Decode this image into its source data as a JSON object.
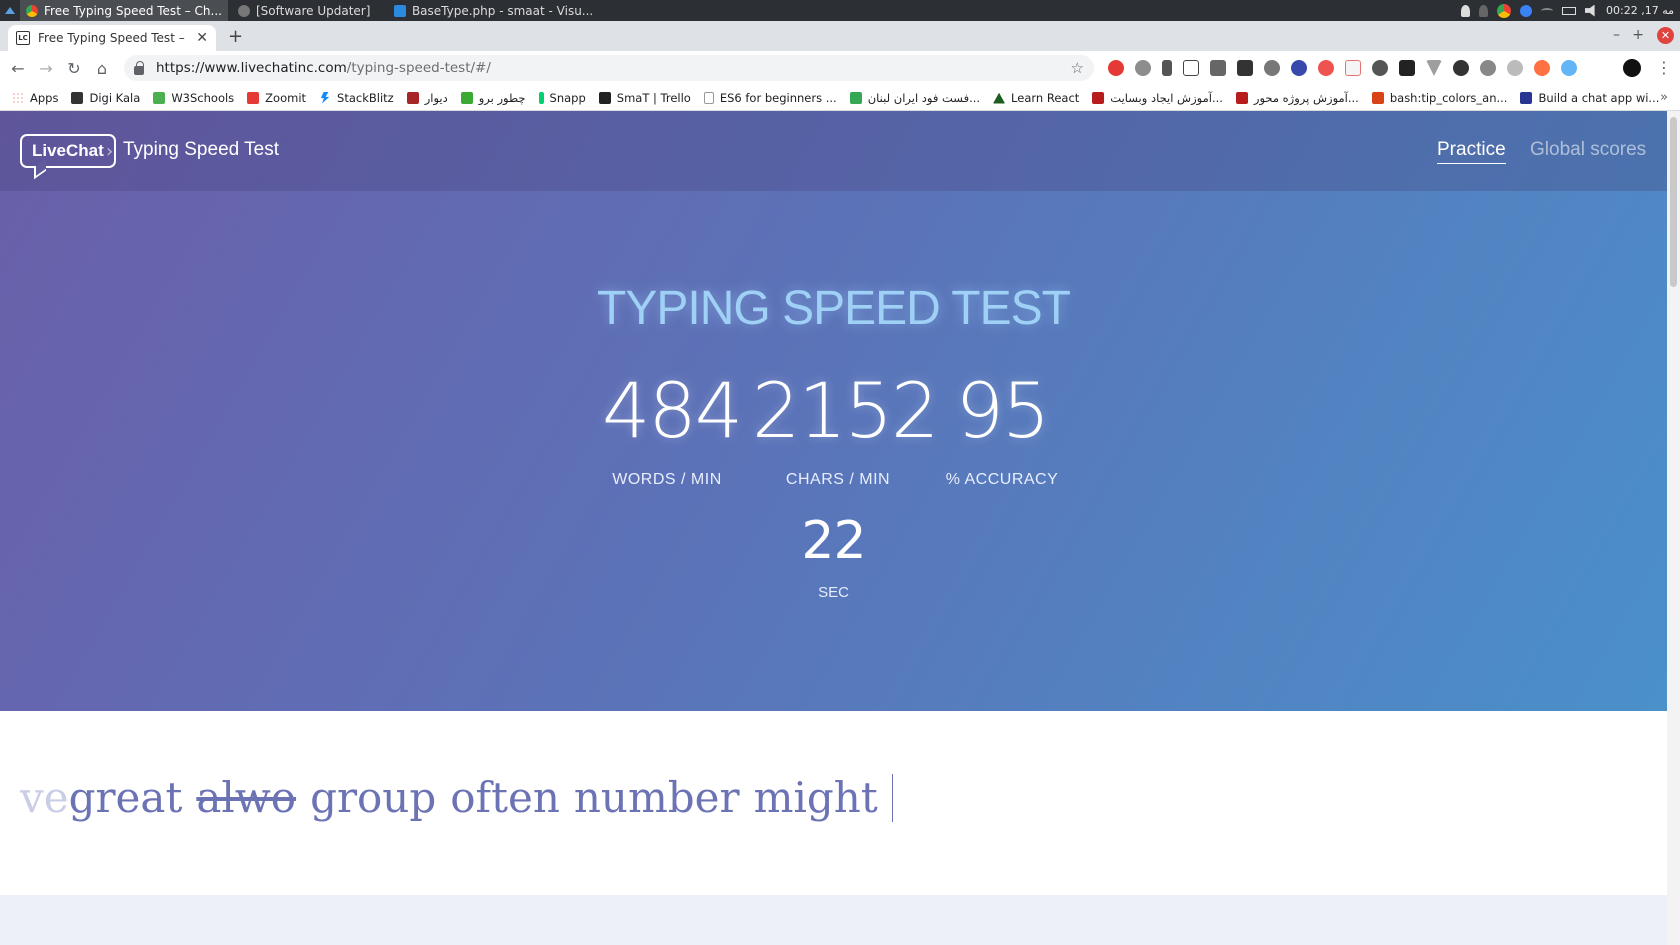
{
  "taskbar": {
    "tasks": [
      {
        "label": "Free Typing Speed Test – Ch..."
      },
      {
        "label": "[Software Updater]"
      },
      {
        "label": "BaseType.php - smaat - Visu..."
      }
    ],
    "clock": "00:22 ,مه 17"
  },
  "tab": {
    "title": "Free Typing Speed Test – Check",
    "favicon": "LC"
  },
  "omnibox": {
    "url_host": "https://www.livechatinc.com",
    "url_path": "/typing-speed-test/#/"
  },
  "bookmarks": [
    {
      "label": "Apps",
      "color": "#e94235"
    },
    {
      "label": "Digi Kala",
      "color": "#333333"
    },
    {
      "label": "W3Schools",
      "color": "#4caf50"
    },
    {
      "label": "Zoomit",
      "color": "#e53935"
    },
    {
      "label": "StackBlitz",
      "color": "#1389fd"
    },
    {
      "label": "دیوار",
      "color": "#a62626"
    },
    {
      "label": "چطور برو",
      "color": "#3aaa35"
    },
    {
      "label": "Snapp",
      "color": "#00d170"
    },
    {
      "label": "SmaT | Trello",
      "color": "#222222"
    },
    {
      "label": "ES6 for beginners ...",
      "color": "#9e9e9e"
    },
    {
      "label": "فست فود ایران لبنان...",
      "color": "#34a853"
    },
    {
      "label": "Learn React",
      "color": "#1b5e20"
    },
    {
      "label": "آموزش ایجاد وبسایت...",
      "color": "#b71c1c"
    },
    {
      "label": "آموزش پروژه محور...",
      "color": "#b71c1c"
    },
    {
      "label": "bash:tip_colors_an...",
      "color": "#d84315"
    },
    {
      "label": "Build a chat app wi...",
      "color": "#283593"
    }
  ],
  "site": {
    "logo": "LiveChat",
    "title": "Typing Speed Test",
    "nav": {
      "practice": "Practice",
      "global": "Global scores"
    }
  },
  "hero": {
    "heading": "TYPING SPEED TEST",
    "wpm": "484",
    "wpm_label": "WORDS / MIN",
    "cpm": "2152",
    "cpm_label": "CHARS / MIN",
    "accuracy": "95",
    "accuracy_label": "% ACCURACY",
    "seconds": "22",
    "seconds_label": "SEC"
  },
  "typing": {
    "faded": "ve",
    "words": [
      "great",
      "alwo",
      "group",
      "often",
      "number",
      "might"
    ],
    "wrong_index": 1
  },
  "colors": {
    "hero_start": "#6a5fa9",
    "hero_end": "#4a90c9",
    "word": "#6c73b5"
  }
}
